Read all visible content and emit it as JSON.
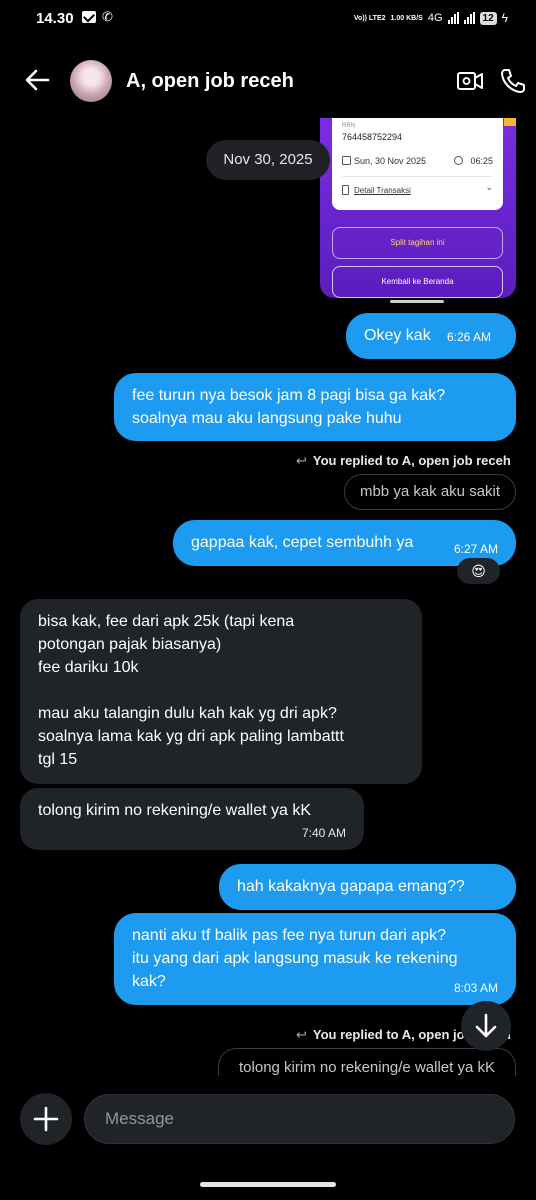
{
  "status_bar": {
    "time": "14.30",
    "volte": "Vo)) LTE2",
    "speed": "1.00 KB/S",
    "network": "4G",
    "battery": "12"
  },
  "header": {
    "title": "A, open job receh"
  },
  "attachment": {
    "ref_label": "RRN",
    "ref_number": "764458752294",
    "date": "Sun, 30 Nov 2025",
    "time": "06:25",
    "detail_label": "Detail Transaksi",
    "split_button": "Split tagihan ini",
    "back_button": "Kembali ke Beranda"
  },
  "date_chip": "Nov 30, 2025",
  "messages": [
    {
      "text": "Okey kak",
      "time": "6:26 AM"
    },
    {
      "line1": "fee turun nya besok jam 8 pagi bisa ga kak?",
      "line2": "soalnya mau aku langsung pake huhu"
    },
    {
      "reply_label": "You replied to A, open job receh",
      "quoted": "mbb ya kak aku sakit"
    },
    {
      "text": "gappaa kak, cepet sembuhh ya",
      "time": "6:27 AM",
      "reaction": "😍"
    },
    {
      "line1": "bisa kak, fee dari apk 25k (tapi kena",
      "line2": "potongan pajak biasanya)",
      "line3": "fee dariku 10k",
      "line4": "mau aku talangin dulu kah kak yg dri apk?",
      "line5": "soalnya lama kak yg dri apk paling lambattt",
      "line6": "tgl 15"
    },
    {
      "text": "tolong kirim no rekening/e wallet ya kK",
      "time": "7:40 AM"
    },
    {
      "text": "hah kakaknya gapapa emang??"
    },
    {
      "line1": "nanti aku tf balik pas fee nya turun dari apk?",
      "line2": "itu yang dari apk langsung masuk ke rekening",
      "line3": "kak?",
      "time": "8:03 AM"
    },
    {
      "reply_label": "You replied to A, open job receh",
      "quoted": "tolong kirim no rekening/e wallet ya kK"
    }
  ],
  "composer": {
    "placeholder": "Message"
  },
  "colors": {
    "outgoing": "#1d9bf0",
    "incoming": "#202327",
    "background": "#000000"
  }
}
